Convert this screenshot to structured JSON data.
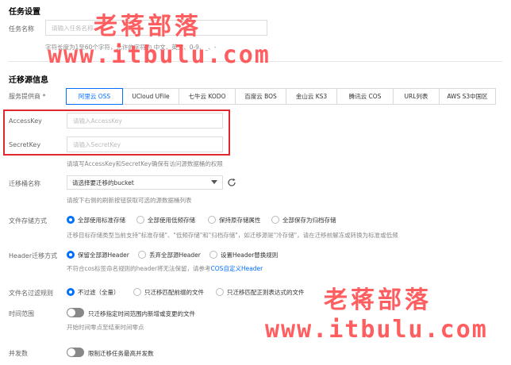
{
  "task_settings": {
    "section_title": "任务设置",
    "task_name_label": "任务名称",
    "task_name_placeholder": "请输入任务名称",
    "task_name_hint": "字符长度为1至60个字符，允许的字符为 中文、英文、0-9、_、-"
  },
  "source_info": {
    "section_title": "迁移源信息",
    "provider_label": "服务提供商 *",
    "providers": [
      "阿里云 OSS",
      "UCloud UFile",
      "七牛云 KODO",
      "百度云 BOS",
      "金山云 KS3",
      "腾讯云 COS",
      "URL列表",
      "AWS S3中国区"
    ],
    "accesskey_label": "AccessKey",
    "accesskey_placeholder": "请输入AccessKey",
    "secretkey_label": "SecretKey",
    "secretkey_placeholder": "请输入SecretKey",
    "key_hint": "请填写AccessKey和SecretKey确保有访问源数据桶的权限",
    "bucket_label": "迁移桶名称",
    "bucket_select_value": "请选择要迁移的bucket",
    "bucket_hint": "请按下右侧的刷新按钮获取可选的源数据桶列表",
    "storage_label": "文件存储方式",
    "storage_options": [
      "全部使用标准存储",
      "全部使用低频存储",
      "保持原存储属性",
      "全部保存为归档存储"
    ],
    "storage_hint": "迁移目标存储类型当前支持\"标准存储\"、\"低频存储\"和\"归档存储\"，如迁移源是\"冷存储\"，请在迁移前解冻或转换为标准或低频",
    "header_label": "Header迁移方式",
    "header_options": [
      "保留全部源Header",
      "丢弃全部源Header",
      "设置Header替换规则"
    ],
    "header_hint": "不符合cos标签命名规则的header将无法保留，请参考",
    "header_hint_link": "COS自定义Header",
    "filter_label": "文件名过滤规则",
    "filter_options": [
      "不过滤（全量）",
      "只迁移匹配前缀的文件",
      "只迁移匹配正则表达式的文件"
    ],
    "time_label": "时间范围",
    "time_toggle_text": "只迁移指定时间范围内新增或变更的文件",
    "time_hint": "开始时间零点至结束时间零点",
    "concurrency_label": "并发数",
    "concurrency_toggle_text": "限制迁移任务最高并发数"
  },
  "watermark": {
    "brand": "老蒋部落",
    "url": "www.itbulu.com"
  },
  "colors": {
    "accent": "#006eff",
    "highlight_border": "#e0282e",
    "watermark": "#ff4d4f"
  }
}
